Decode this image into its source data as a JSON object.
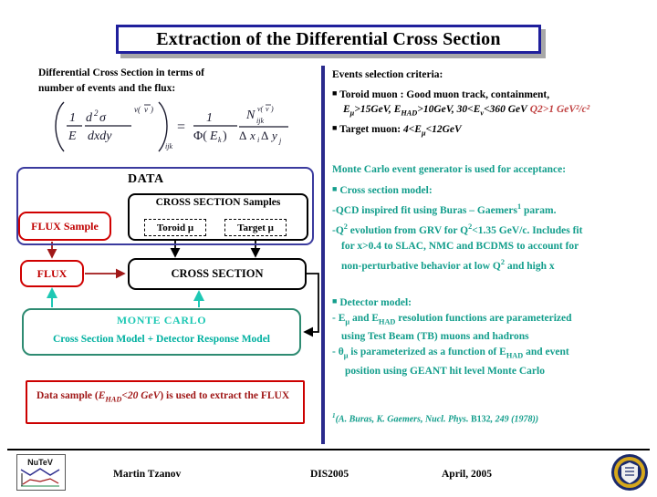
{
  "title": "Extraction of the Differential Cross Section",
  "left": {
    "heading_line1": "Differential Cross Section in terms of",
    "heading_line2": "number of events and the flux:",
    "formula_description": "(1/E d2sigma/dxdy)^nu(nubar) ijk = 1/Phi(E_k) * N^nu(nubar)_ijk / (Delta x_i Delta y_j)",
    "diagram": {
      "data_label": "DATA",
      "cross_section_samples_label": "CROSS SECTION Samples",
      "toroid_label": "Toroid μ",
      "target_label": "Target μ",
      "flux_sample_label": "FLUX Sample",
      "flux_label": "FLUX",
      "cross_section_label": "CROSS SECTION",
      "monte_carlo_title": "MONTE CARLO",
      "monte_carlo_subtitle": "Cross Section Model + Detector Response Model"
    },
    "data_sample_note": {
      "part1": "Data sample (",
      "part2": "E",
      "part3": "HAD",
      "part4": "<20 GeV",
      "part5": ") is used to extract",
      "part6": "the FLUX"
    }
  },
  "right": {
    "selection": {
      "heading": "Events selection criteria:",
      "bullet1_head": "Toroid muon : Good muon track, containment,",
      "bullet1_formula_a": "E",
      "bullet1_formula_a_sub": "μ",
      "bullet1_formula_b": ">15GeV, ",
      "bullet1_formula_c": "E",
      "bullet1_formula_c_sub": "HAD",
      "bullet1_formula_d": ">10GeV, 30<",
      "bullet1_formula_e": "E",
      "bullet1_formula_e_sub": "ν",
      "bullet1_formula_f": "<360 GeV",
      "bullet1_red": "Q2>1 GeV²/c²",
      "bullet2_head": "Target muon: ",
      "bullet2_formula_a": "4<E",
      "bullet2_formula_a_sub": "μ",
      "bullet2_formula_b": "<12GeV"
    },
    "monte_carlo": {
      "heading": "Monte Carlo event generator is used for acceptance:",
      "bullet1": "Cross section model:",
      "line1": "-QCD inspired fit using Buras – Gaemers",
      "line1_sup": "1",
      "line1_tail": " param.",
      "line2_a": "-Q",
      "line2_a_sup": "2",
      "line2_b": " evolution from GRV for Q",
      "line2_b_sup": "2",
      "line2_c": "<1.35 GeV/c. Includes fit",
      "line3": "for x>0.4 to SLAC, NMC and  BCDMS  to account for",
      "line4_a": "non-perturbative behavior at low Q",
      "line4_sup": "2",
      "line4_b": " and high x"
    },
    "detector": {
      "bullet": "Detector model:",
      "line1_a": "- E",
      "line1_a_sub": "μ",
      "line1_b": " and E",
      "line1_b_sub": "HAD",
      "line1_c": " resolution functions are parameterized",
      "line2": "using Test Beam (TB) muons and hadrons",
      "line3_a": "- θ",
      "line3_a_sub": "μ",
      "line3_b": " is parameterized as a function of E",
      "line3_b_sub": "HAD",
      "line3_c": " and event",
      "line4": "position using GEANT hit level Monte Carlo"
    },
    "reference": {
      "sup": "1",
      "text_a": "(A. Buras, K. Gaemers, Nucl. Phys. ",
      "bold": "B132",
      "text_b": ", 249 (1978))"
    }
  },
  "footer": {
    "author": "Martin Tzanov",
    "conference": "DIS2005",
    "date": "April, 2005",
    "logo_left": "NuTeV",
    "logo_right": "university-seal"
  },
  "colors": {
    "title_border": "#1f1f9c",
    "divider": "#2a2a8c",
    "red": "#c00000",
    "teal": "#139e8c",
    "mc_cyan": "#1ec8b4",
    "black": "#000000"
  }
}
